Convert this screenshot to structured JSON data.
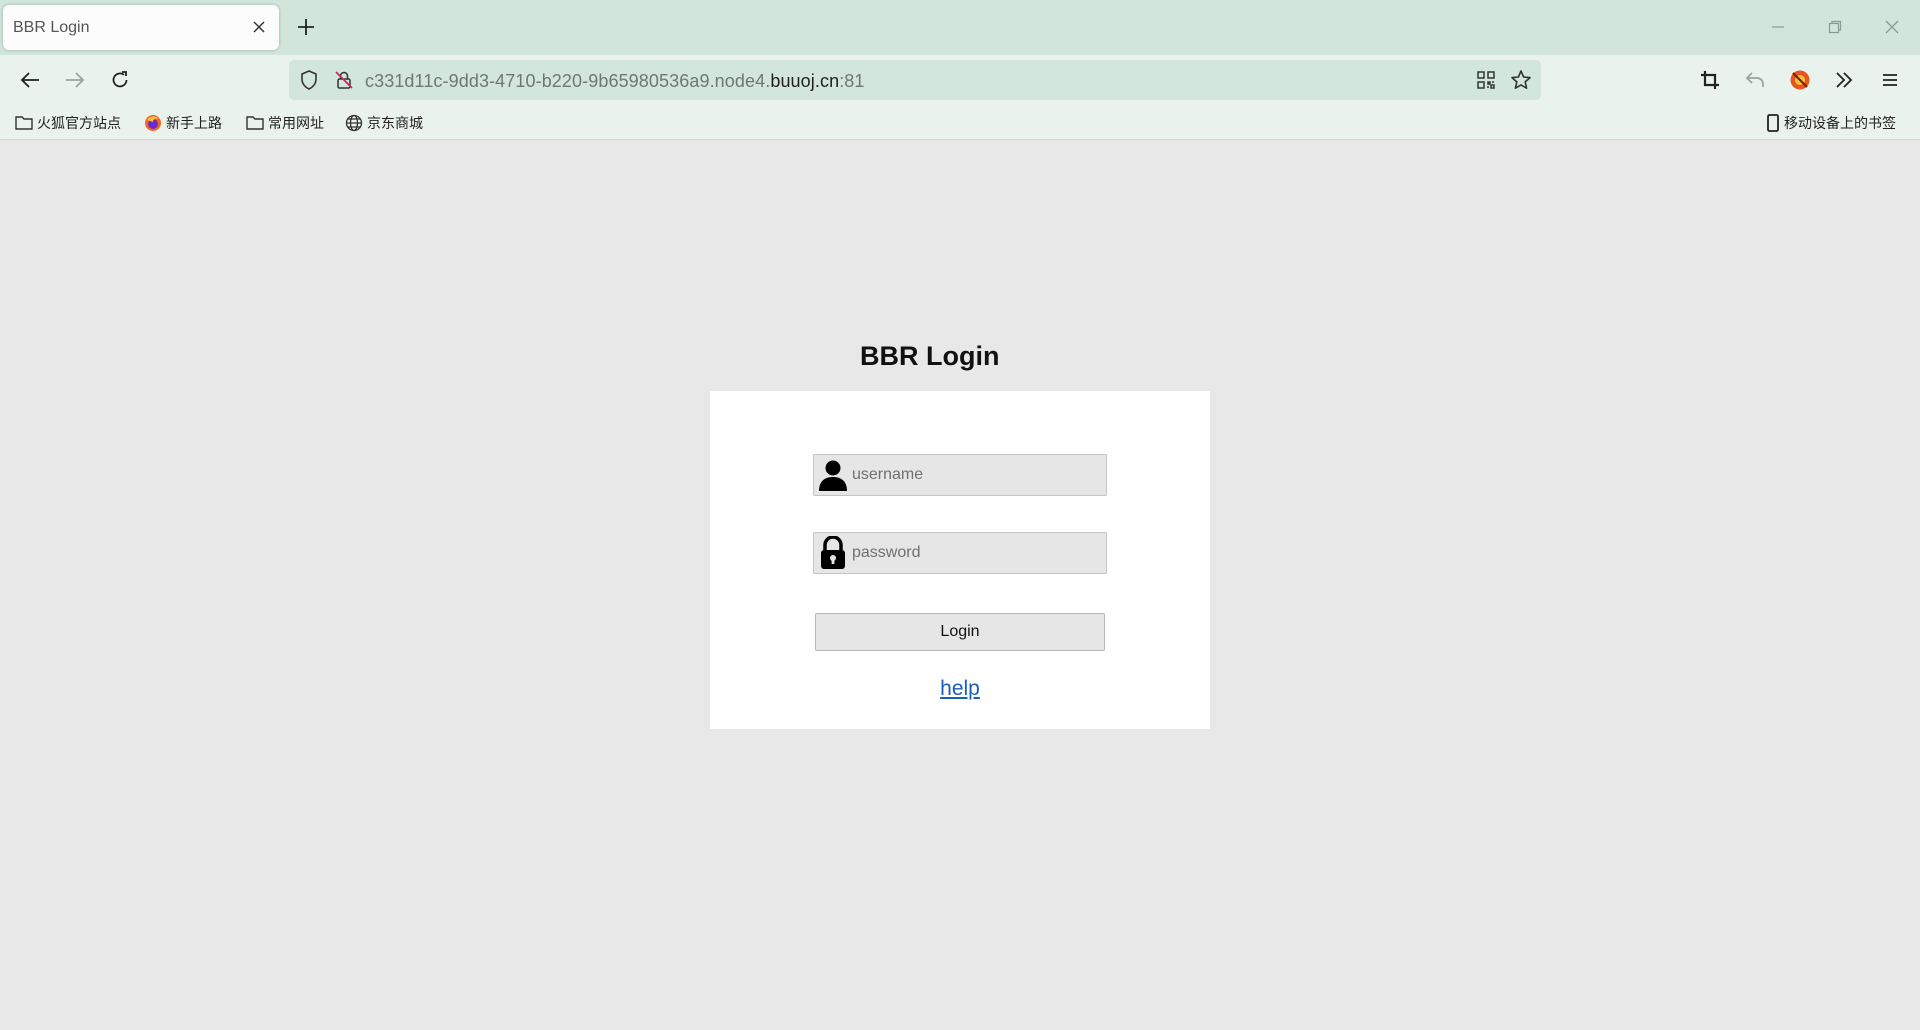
{
  "browser": {
    "tab": {
      "title": "BBR Login"
    },
    "url": {
      "prefix": "c331d11c-9dd3-4710-b220-9b65980536a9.node4.",
      "domain": "buuoj.cn",
      "port": ":81"
    },
    "bookmarks": [
      {
        "label": "火狐官方站点",
        "icon": "folder-icon"
      },
      {
        "label": "新手上路",
        "icon": "firefox-icon"
      },
      {
        "label": "常用网址",
        "icon": "folder-icon"
      },
      {
        "label": "京东商城",
        "icon": "globe-icon"
      }
    ],
    "mobile_bookmarks": "移动设备上的书签"
  },
  "page": {
    "title": "BBR Login",
    "username_placeholder": "username",
    "password_placeholder": "password",
    "login_label": "Login",
    "help_label": "help"
  },
  "colors": {
    "tabbar": "#d1e5db",
    "toolbar": "#e9f2ed",
    "page_bg": "#e8e8e8",
    "card_bg": "#ffffff",
    "link": "#1a5fb4"
  }
}
